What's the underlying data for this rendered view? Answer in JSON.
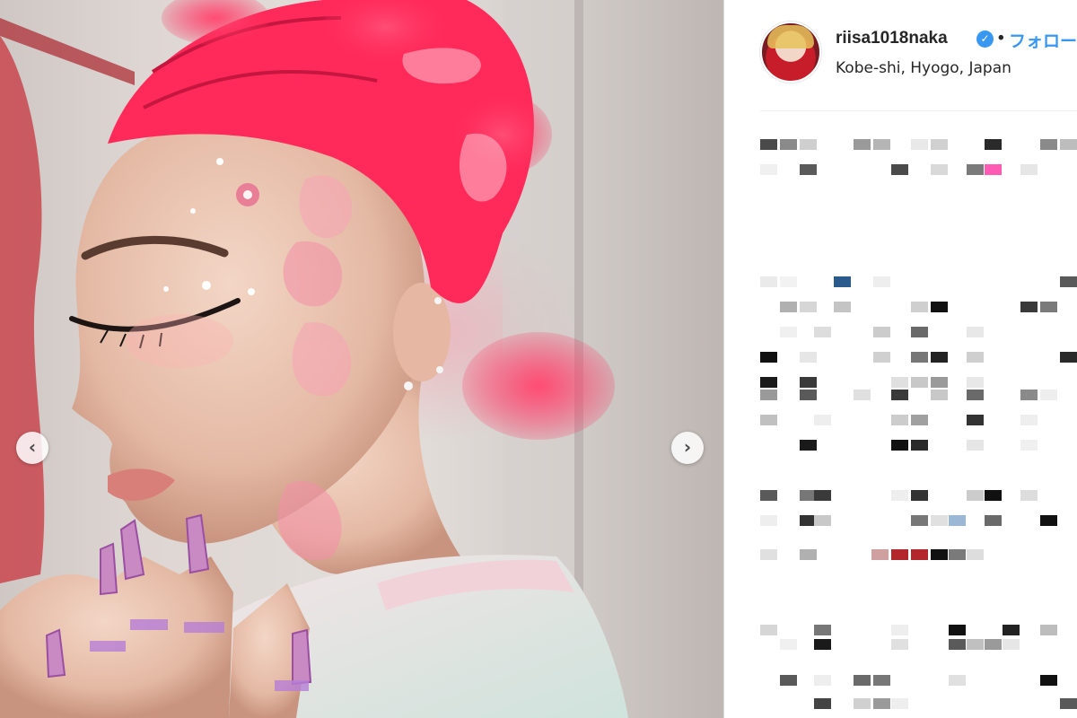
{
  "post": {
    "username": "riisa1018naka",
    "follow_label": "フォロー",
    "separator": "•",
    "location": "Kobe-shi, Hyogo, Japan",
    "verified_icon": "verified-check-icon",
    "verified_glyph": "✓"
  },
  "carousel": {
    "prev_icon": "chevron-left-icon",
    "next_icon": "chevron-right-icon",
    "prev_glyph": "‹",
    "next_glyph": "›"
  },
  "colors": {
    "link": "#3897f0",
    "text": "#262626",
    "hair": "#ff2a5a",
    "divider": "#dbdbdb"
  },
  "caption_status": "pixelated / obscured text"
}
